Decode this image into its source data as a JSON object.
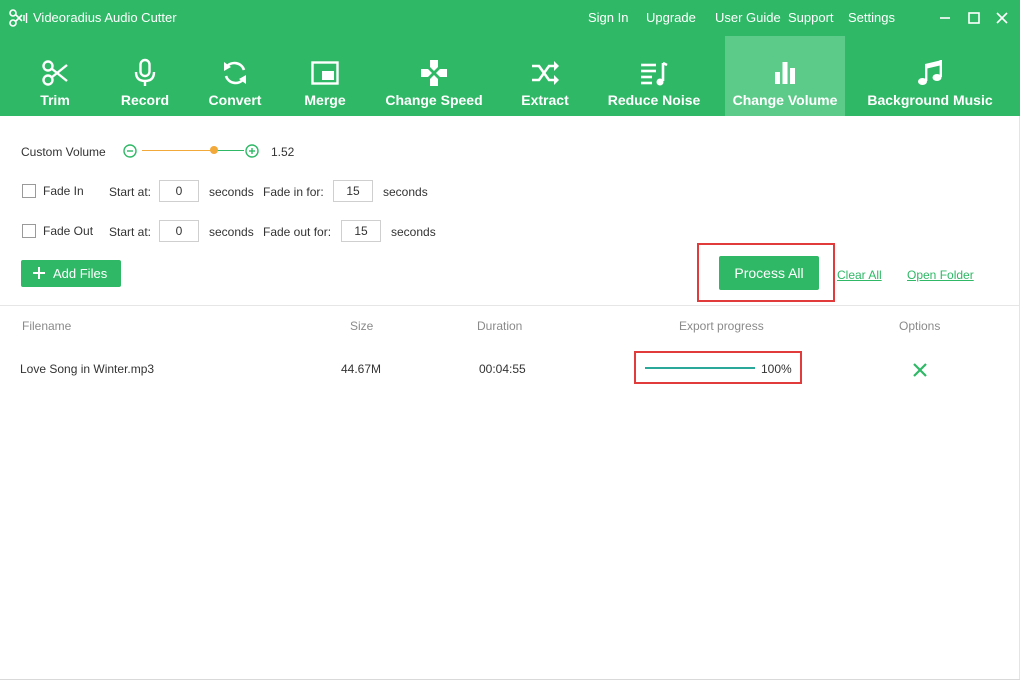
{
  "app": {
    "title": "Videoradius Audio Cutter"
  },
  "top_links": [
    {
      "label": "Sign In"
    },
    {
      "label": "Upgrade"
    },
    {
      "label": "User Guide"
    },
    {
      "label": "Support"
    },
    {
      "label": "Settings"
    }
  ],
  "window_controls": [
    "minimize-icon",
    "maximize-icon",
    "close-icon"
  ],
  "toolbar": {
    "active": "Change Volume",
    "items": [
      {
        "label": "Trim",
        "icon": "scissors-icon"
      },
      {
        "label": "Record",
        "icon": "microphone-icon"
      },
      {
        "label": "Convert",
        "icon": "sync-icon"
      },
      {
        "label": "Merge",
        "icon": "merge-icon"
      },
      {
        "label": "Change Speed",
        "icon": "gamepad-icon"
      },
      {
        "label": "Extract",
        "icon": "shuffle-icon"
      },
      {
        "label": "Reduce Noise",
        "icon": "music-list-icon"
      },
      {
        "label": "Change Volume",
        "icon": "bar-chart-icon"
      },
      {
        "label": "Background Music",
        "icon": "music-note-icon"
      }
    ]
  },
  "volume": {
    "label": "Custom Volume",
    "value": "1.52",
    "slider_fraction": 0.71
  },
  "fade_in": {
    "label": "Fade In",
    "checked": false,
    "start_label": "Start at:",
    "start_value": "0",
    "start_unit": "seconds",
    "duration_label": "Fade in for:",
    "duration_value": "15",
    "duration_unit": "seconds"
  },
  "fade_out": {
    "label": "Fade Out",
    "checked": false,
    "start_label": "Start at:",
    "start_value": "0",
    "start_unit": "seconds",
    "duration_label": "Fade out for:",
    "duration_value": "15",
    "duration_unit": "seconds"
  },
  "actions": {
    "add_files": "Add Files",
    "process_all": "Process All",
    "clear_all": "Clear All",
    "open_folder": "Open Folder"
  },
  "table": {
    "headers": {
      "filename": "Filename",
      "size": "Size",
      "duration": "Duration",
      "progress": "Export progress",
      "options": "Options"
    },
    "rows": [
      {
        "filename": "Love Song in Winter.mp3",
        "size": "44.67M",
        "duration": "00:04:55",
        "progress_text": "100%",
        "progress_fraction": 1.0
      }
    ]
  },
  "colors": {
    "accent": "#2fb866",
    "active_tab": "#5ccb89",
    "slider_orange": "#f3a83a",
    "progress_teal": "#2aa89a",
    "highlight_red": "#e23b3b"
  }
}
